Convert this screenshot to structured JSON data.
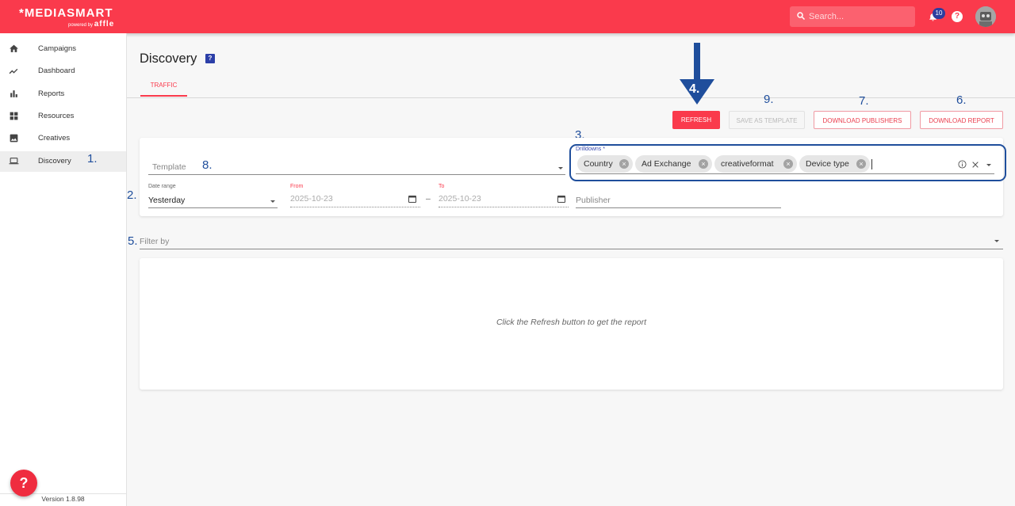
{
  "topbar": {
    "brand": "*MEDIASMART",
    "brand_sub_prefix": "powered by",
    "brand_sub_name": "affle",
    "search_placeholder": "Search...",
    "notification_count": "10",
    "help_label": "?",
    "accent_color": "#fa3a4c"
  },
  "sidebar": {
    "items": [
      {
        "label": "Campaigns",
        "icon": "home-icon"
      },
      {
        "label": "Dashboard",
        "icon": "trending-icon"
      },
      {
        "label": "Reports",
        "icon": "bar-chart-icon"
      },
      {
        "label": "Resources",
        "icon": "widgets-icon"
      },
      {
        "label": "Creatives",
        "icon": "image-icon"
      },
      {
        "label": "Discovery",
        "icon": "laptop-icon",
        "active": true
      }
    ],
    "version": "Version 1.8.98",
    "help_fab": "?"
  },
  "page": {
    "title": "Discovery",
    "tab": "TRAFFIC"
  },
  "toolbar": {
    "refresh": "REFRESH",
    "save_template": "SAVE AS TEMPLATE",
    "download_publishers": "DOWNLOAD PUBLISHERS",
    "download_report": "DOWNLOAD REPORT"
  },
  "form": {
    "template_placeholder": "Template",
    "drilldowns_label": "Drilldowns *",
    "drilldowns": [
      "Country",
      "Ad Exchange",
      "creativeformat",
      "Device type"
    ],
    "date_range_label": "Date range",
    "date_range_value": "Yesterday",
    "from_label": "From",
    "from_value": "2025-10-23",
    "to_label": "To",
    "to_value": "2025-10-23",
    "range_separator": "–",
    "publisher_placeholder": "Publisher",
    "filter_placeholder": "Filter by"
  },
  "report": {
    "empty_message": "Click the Refresh button to get the report"
  },
  "annotations": {
    "a1": "1.",
    "a2": "2.",
    "a3": "3.",
    "a4": "4.",
    "a5": "5.",
    "a6": "6.",
    "a7": "7.",
    "a8": "8.",
    "a9": "9.",
    "color": "#1f4e9c"
  }
}
